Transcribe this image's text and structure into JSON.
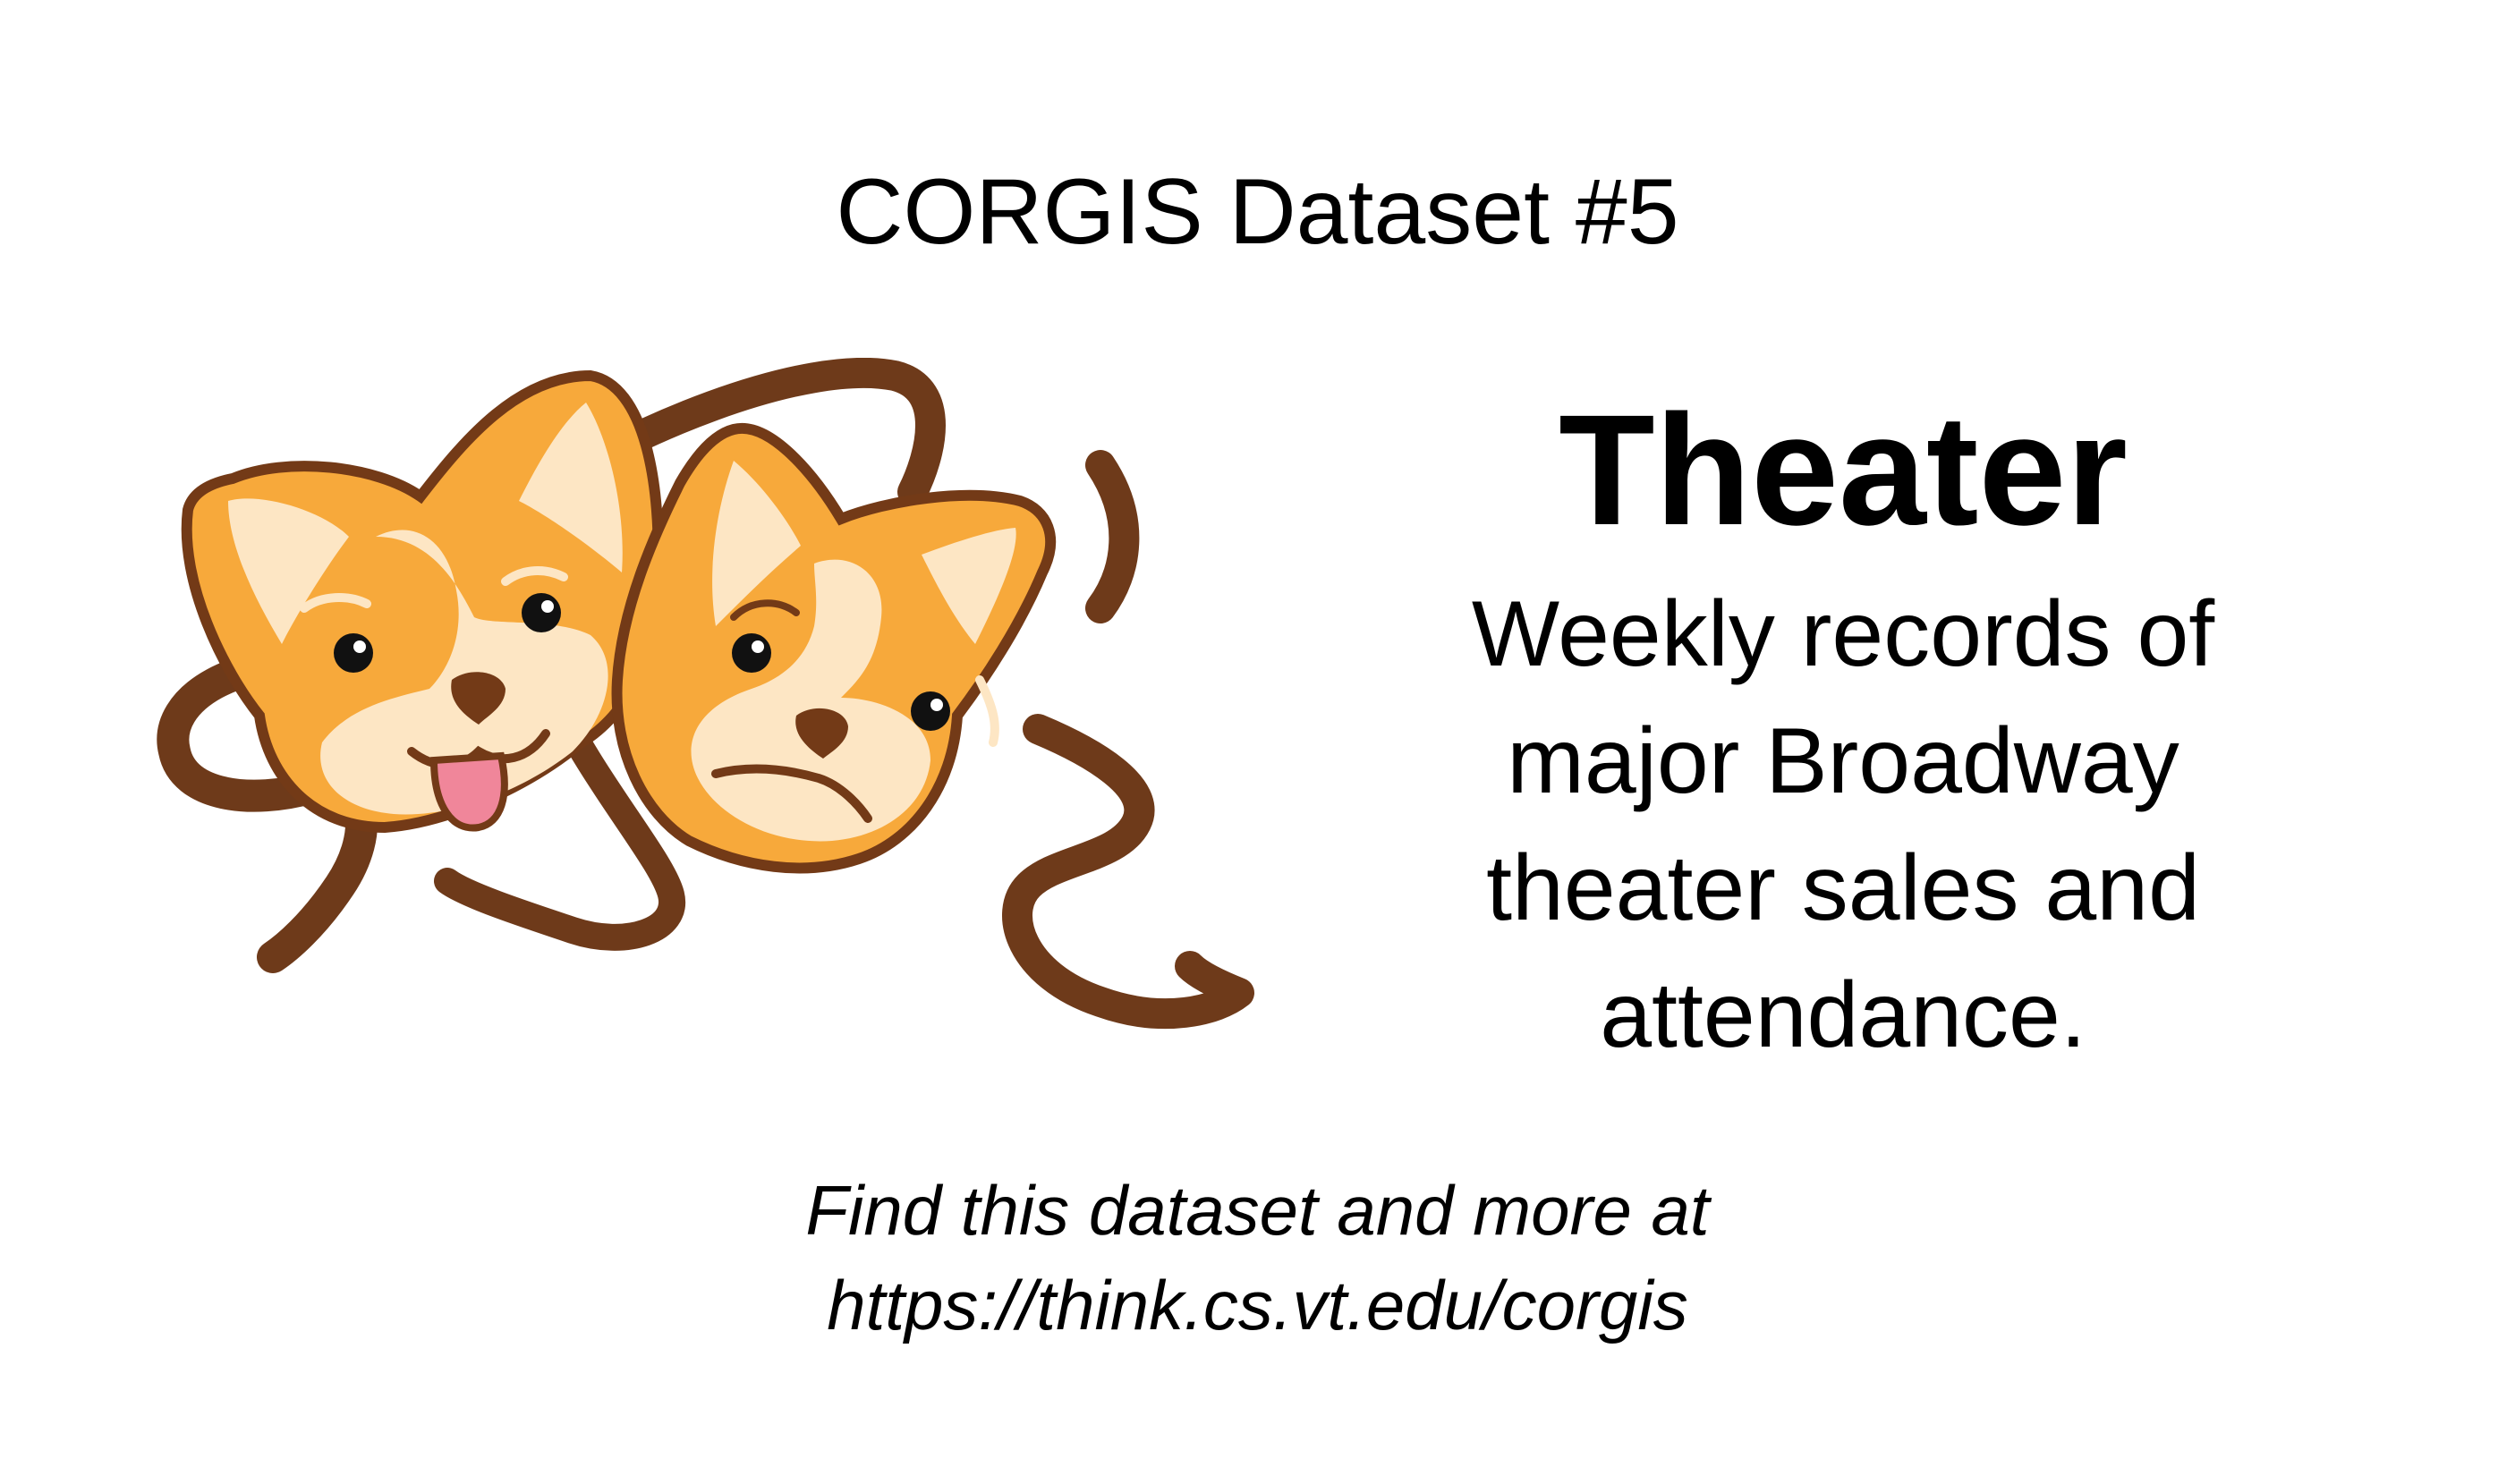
{
  "header": {
    "text": "CORGIS Dataset #5"
  },
  "title": {
    "text": "Theater"
  },
  "description": {
    "lines": [
      "Weekly records of",
      "major Broadway",
      "theater sales and",
      "attendance."
    ]
  },
  "footer": {
    "line1": "Find this dataset and more at",
    "line2": "https://think.cs.vt.edu/corgis"
  },
  "illustration": {
    "icon": "corgi-theater-masks-icon",
    "colors": {
      "fur": "#F7A93B",
      "cream": "#FDE6C4",
      "outline": "#733A17",
      "ribbon": "#6E3A1A",
      "tongue": "#F0869A",
      "eye": "#111111"
    }
  }
}
